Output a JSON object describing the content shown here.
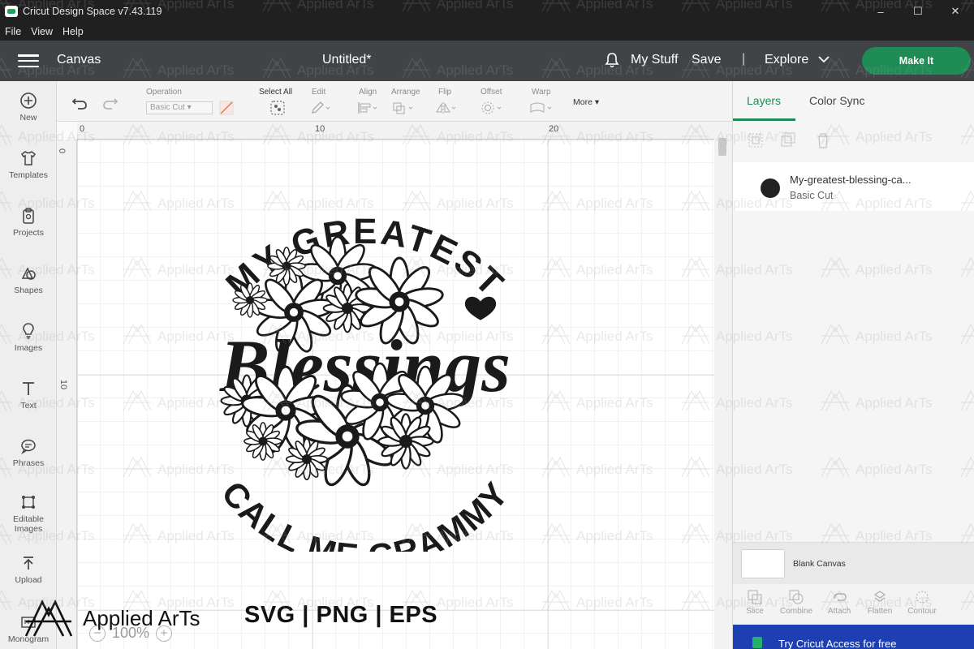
{
  "window": {
    "title": "Cricut Design Space  v7.43.119",
    "controls": {
      "minimize": "–",
      "maximize": "☐",
      "close": "✕"
    }
  },
  "menu": [
    "File",
    "View",
    "Help"
  ],
  "header": {
    "section": "Canvas",
    "document_title": "Untitled*",
    "my_stuff": "My Stuff",
    "save": "Save",
    "divider": "|",
    "explore": "Explore",
    "make_it": "Make It",
    "colors": {
      "header_bg": "#414447",
      "make_it_bg": "#1e8c54"
    }
  },
  "sidebar": {
    "items": [
      {
        "label": "New",
        "icon": "plus-circle-icon"
      },
      {
        "label": "Templates",
        "icon": "shirt-icon"
      },
      {
        "label": "Projects",
        "icon": "clipboard-icon"
      },
      {
        "label": "Shapes",
        "icon": "shapes-icon"
      },
      {
        "label": "Images",
        "icon": "lightbulb-icon"
      },
      {
        "label": "Text",
        "icon": "text-icon"
      },
      {
        "label": "Phrases",
        "icon": "speech-bubble-icon"
      },
      {
        "label": "Editable Images",
        "icon": "editable-image-icon"
      },
      {
        "label": "Upload",
        "icon": "upload-icon"
      },
      {
        "label": "Monogram",
        "icon": "monogram-icon"
      }
    ]
  },
  "toolbar": {
    "operation_label": "Operation",
    "operation_value": "Basic Cut",
    "select_all": "Select All",
    "edit": "Edit",
    "align": "Align",
    "arrange": "Arrange",
    "flip": "Flip",
    "offset": "Offset",
    "warp": "Warp",
    "more": "More"
  },
  "canvas": {
    "ruler_top": [
      "0",
      "10",
      "20"
    ],
    "ruler_left": [
      "0",
      "10"
    ],
    "zoom": "100%",
    "design": {
      "top_arc_text": "MY GREATEST",
      "script_text": "Blessings",
      "bottom_arc_text": "CALL ME GRAMMY"
    }
  },
  "panel": {
    "tabs": [
      "Layers",
      "Color Sync"
    ],
    "active_tab": "Layers",
    "layer": {
      "name": "My-greatest-blessing-ca...",
      "operation": "Basic Cut"
    },
    "blank_canvas": "Blank Canvas",
    "tools": [
      "Slice",
      "Combine",
      "Attach",
      "Flatten",
      "Contour"
    ],
    "try_access": "Try Cricut Access for free"
  },
  "branding": {
    "name": "Applied ArTs",
    "formats": "SVG | PNG | EPS",
    "watermark": "Applied ArTs"
  }
}
